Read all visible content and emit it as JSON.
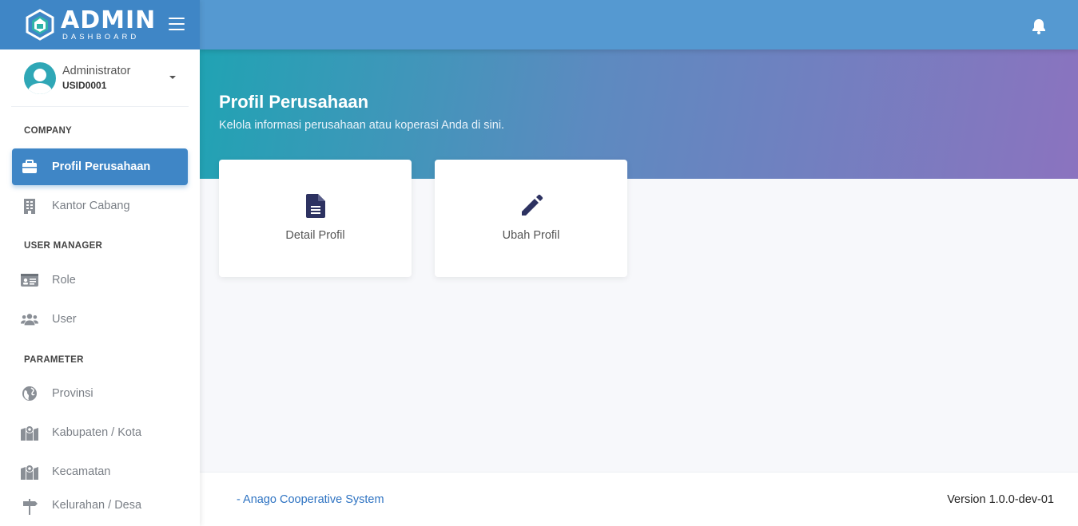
{
  "brand": {
    "logo_main": "ADMIN",
    "logo_sub": "DASHBOARD"
  },
  "user": {
    "name": "Administrator",
    "id": "USID0001"
  },
  "sidebar": {
    "sections": [
      {
        "title": "COMPANY",
        "items": [
          {
            "label": "Profil Perusahaan",
            "icon": "briefcase-icon",
            "active": true
          },
          {
            "label": "Kantor Cabang",
            "icon": "building-icon",
            "active": false
          }
        ]
      },
      {
        "title": "USER MANAGER",
        "items": [
          {
            "label": "Role",
            "icon": "id-card-icon",
            "active": false
          },
          {
            "label": "User",
            "icon": "users-icon",
            "active": false
          }
        ]
      },
      {
        "title": "PARAMETER",
        "items": [
          {
            "label": "Provinsi",
            "icon": "globe-icon",
            "active": false
          },
          {
            "label": "Kabupaten / Kota",
            "icon": "map-marker-icon",
            "active": false
          },
          {
            "label": "Kecamatan",
            "icon": "map-marker-icon",
            "active": false
          },
          {
            "label": "Kelurahan / Desa",
            "icon": "signpost-icon",
            "active": false
          }
        ]
      }
    ]
  },
  "header": {
    "title": "Profil Perusahaan",
    "subtitle": "Kelola informasi perusahaan atau koperasi Anda di sini."
  },
  "cards": [
    {
      "label": "Detail Profil",
      "icon": "document-icon"
    },
    {
      "label": "Ubah Profil",
      "icon": "pencil-icon"
    }
  ],
  "footer": {
    "left": "- Anago Cooperative System",
    "right": "Version 1.0.0-dev-01"
  },
  "colors": {
    "primary": "#3f86c6",
    "topbar": "#5599d1",
    "hero_start": "#20a3b3",
    "hero_end": "#8b73bf",
    "card_icon": "#2d3261"
  }
}
